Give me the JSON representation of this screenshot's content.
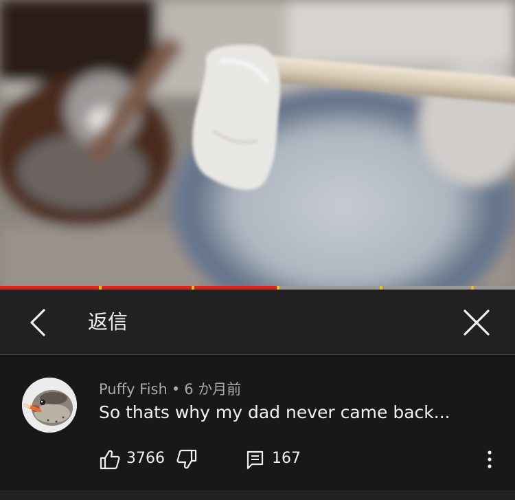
{
  "video": {
    "progress": 0.538,
    "buffered_to": 1.0,
    "chapter_markers": [
      0.195,
      0.375,
      0.54,
      0.74,
      0.917
    ]
  },
  "header": {
    "title": "返信"
  },
  "comment": {
    "author": "Puffy Fish",
    "separator": "•",
    "time": "6 か月前",
    "text": "So thats why my dad never came back...",
    "like_count": "3766",
    "reply_count": "167"
  },
  "icons": {
    "back": "chevron-left-icon",
    "close": "close-icon",
    "like": "thumbs-up-icon",
    "dislike": "thumbs-down-icon",
    "reply": "comment-icon",
    "more": "more-vertical-icon"
  },
  "colors": {
    "accent": "#e62117",
    "marker": "#f2c200",
    "panel": "#212121",
    "background": "#181818"
  }
}
